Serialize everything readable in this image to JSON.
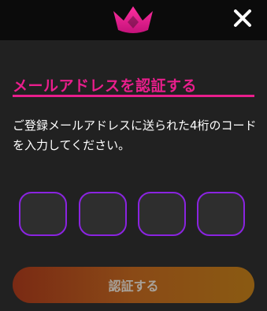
{
  "header": {
    "logo_icon": "crown-icon",
    "close_icon": "close-icon",
    "logo_color": "#e91e8c"
  },
  "main": {
    "title": "メールアドレスを認証する",
    "description": "ご登録メールアドレスに送られた4桁のコードを入力してください。",
    "accent_color": "#e91e8c",
    "code_inputs": [
      {
        "value": ""
      },
      {
        "value": ""
      },
      {
        "value": ""
      },
      {
        "value": ""
      }
    ],
    "code_border_color": "#8a24e0",
    "verify_label": "認証する"
  }
}
